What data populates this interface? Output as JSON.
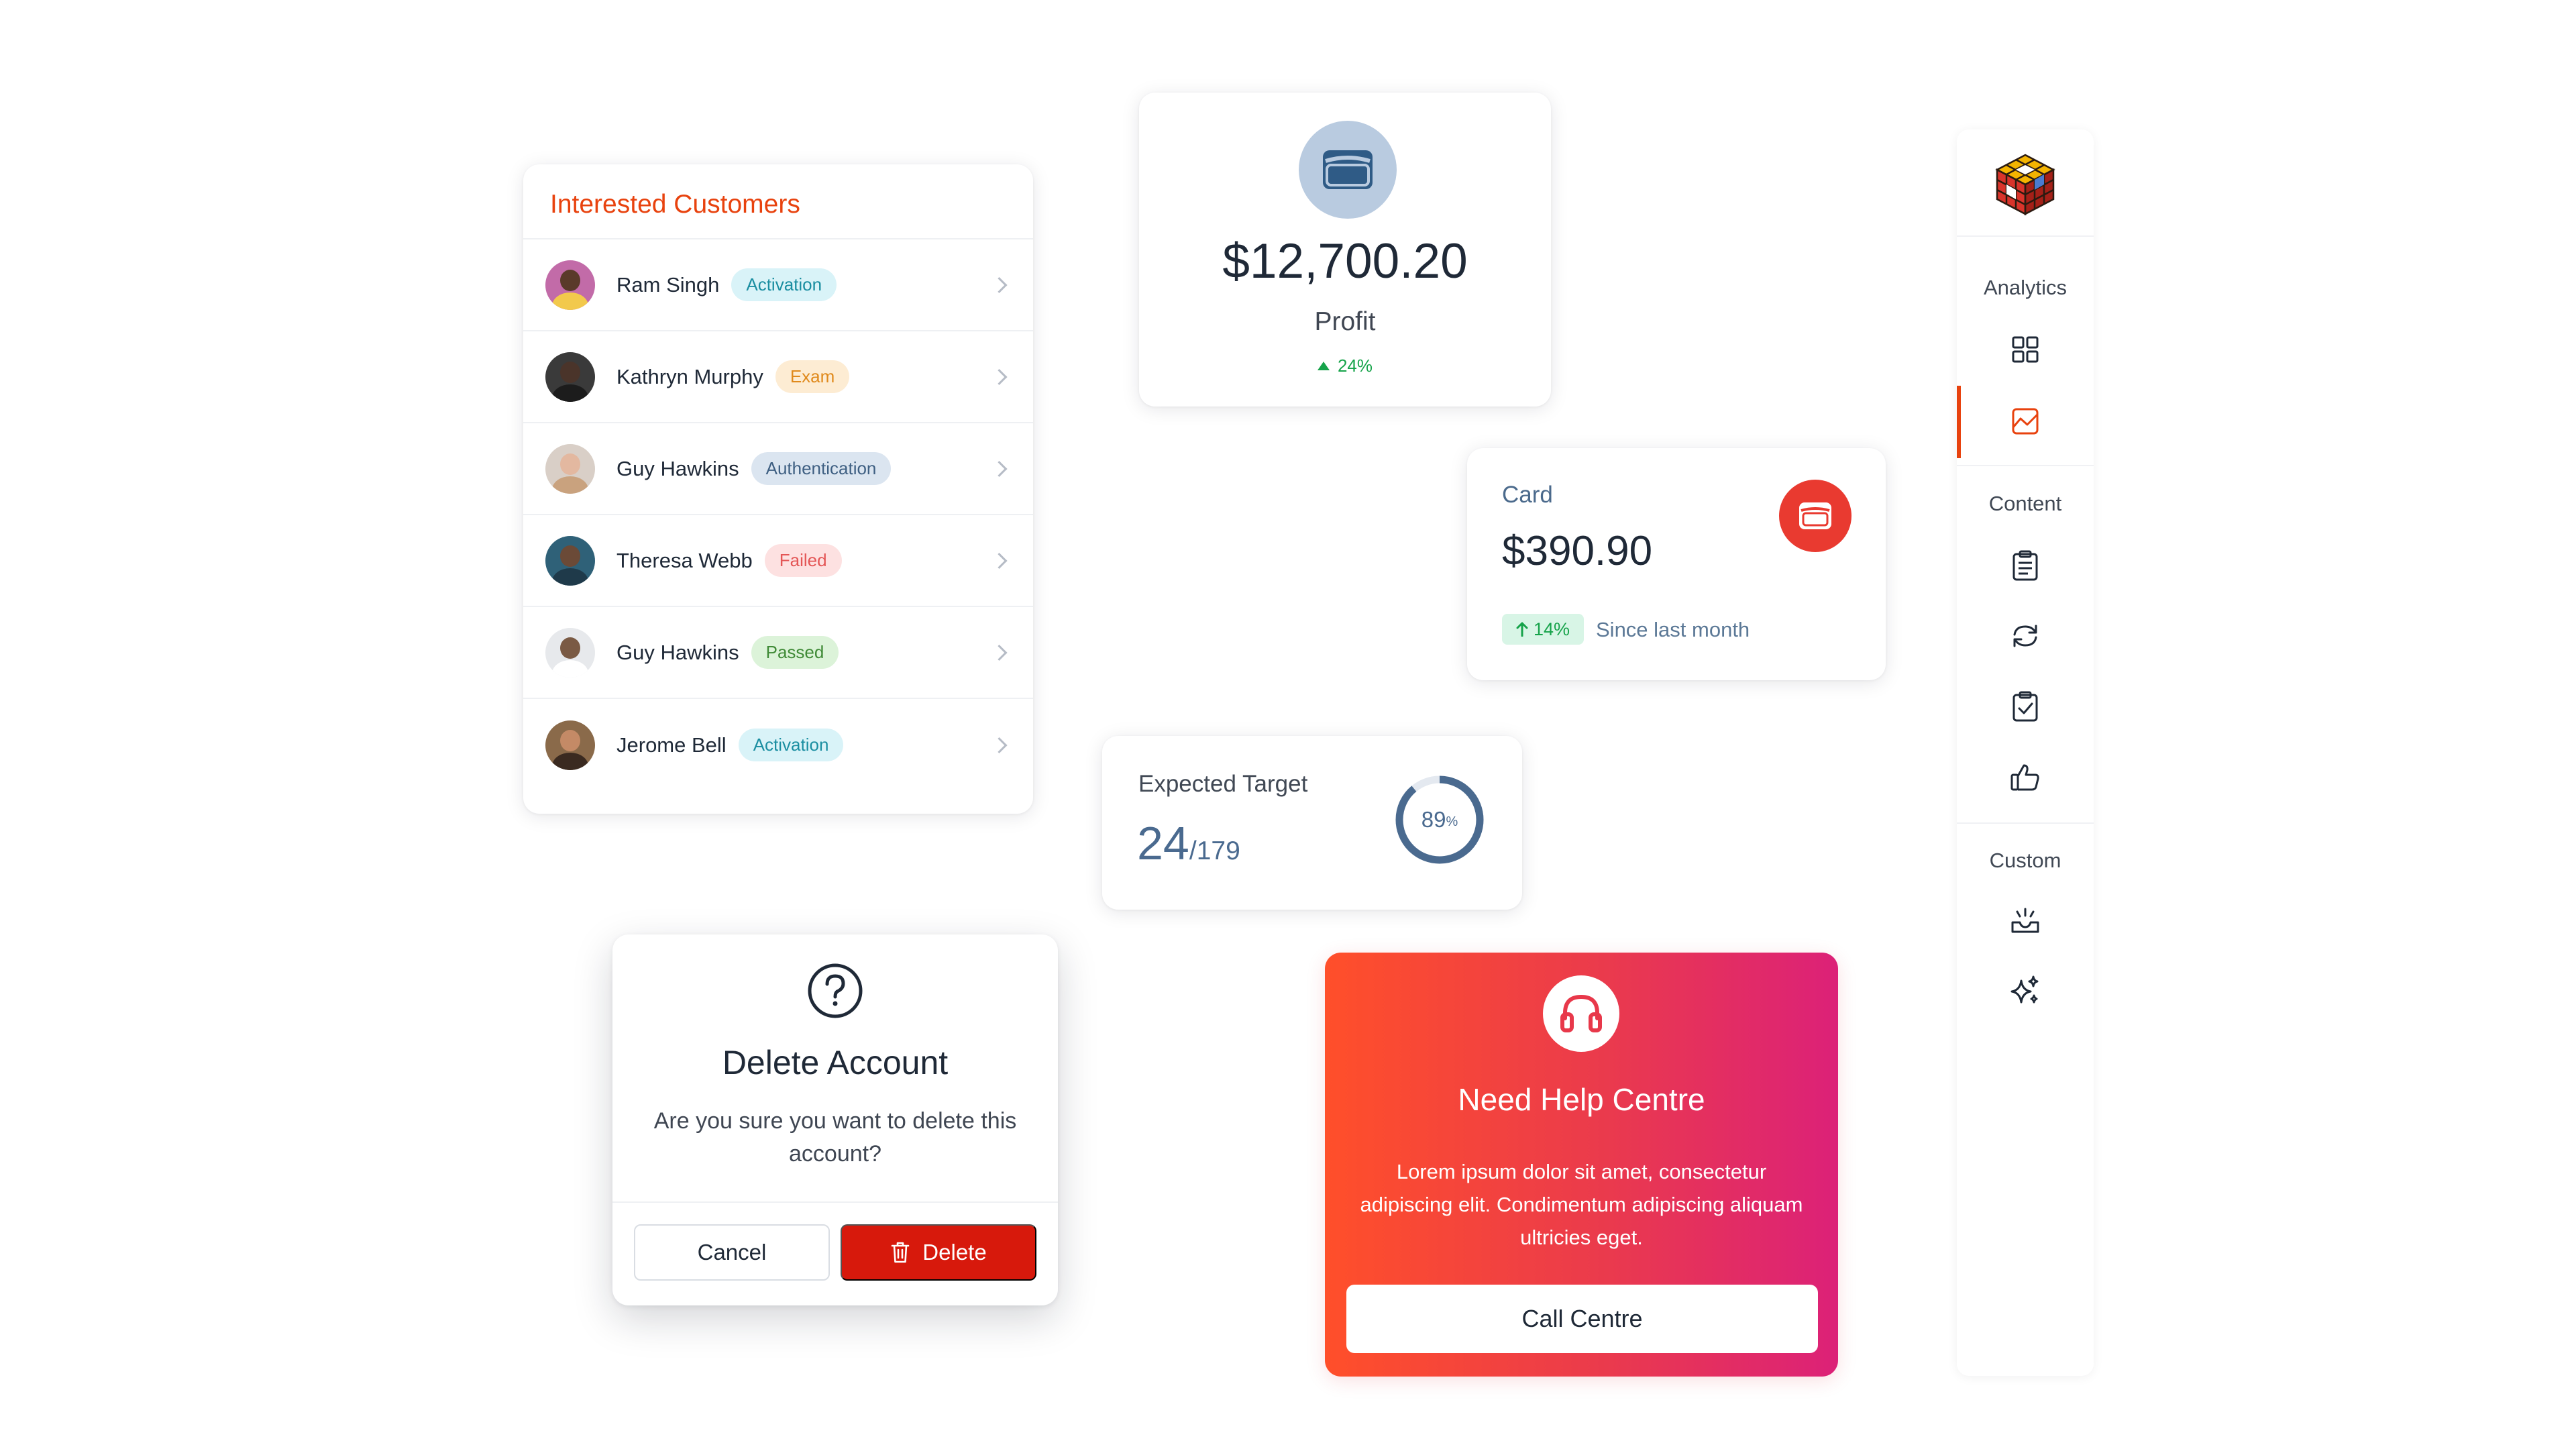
{
  "customers": {
    "title": "Interested Customers",
    "rows": [
      {
        "name": "Ram Singh",
        "status": "Activation",
        "badge_bg": "#d9f3f8",
        "badge_fg": "#1a8ea1",
        "skin": "#5a3a2a",
        "shirt": "#f2c94c",
        "bg": "#c26ba8"
      },
      {
        "name": "Kathryn Murphy",
        "status": "Exam",
        "badge_bg": "#fdecd3",
        "badge_fg": "#e08a1c",
        "skin": "#4a342a",
        "shirt": "#1c1c1c",
        "bg": "#3a3a3a"
      },
      {
        "name": "Guy Hawkins",
        "status": "Authentication",
        "badge_bg": "#dbe5f0",
        "badge_fg": "#3e5f82",
        "skin": "#e3b8a0",
        "shirt": "#c9a27e",
        "bg": "#d9cfc7"
      },
      {
        "name": "Theresa Webb",
        "status": "Failed",
        "badge_bg": "#fde1e1",
        "badge_fg": "#e45656",
        "skin": "#6b4a37",
        "shirt": "#1f3a4a",
        "bg": "#2f6178"
      },
      {
        "name": "Guy Hawkins",
        "status": "Passed",
        "badge_bg": "#dcf3d9",
        "badge_fg": "#3f8a36",
        "skin": "#7a5a44",
        "shirt": "#ffffff",
        "bg": "#e7e9ec"
      },
      {
        "name": "Jerome Bell",
        "status": "Activation",
        "badge_bg": "#d9f3f8",
        "badge_fg": "#1a8ea1",
        "skin": "#c48a66",
        "shirt": "#3a2a20",
        "bg": "#8a6a4a"
      }
    ]
  },
  "profit": {
    "amount": "$12,700.20",
    "label": "Profit",
    "growth": "24%",
    "icon": "wallet-icon"
  },
  "card": {
    "title": "Card",
    "amount": "$390.90",
    "growth": "14%",
    "since": "Since last month",
    "icon": "wallet-icon"
  },
  "target": {
    "title": "Expected Target",
    "value": "24",
    "total": "/179",
    "percent": "89",
    "percent_sign": "%",
    "percent_fraction": 0.89
  },
  "delete_dialog": {
    "title": "Delete Account",
    "message": "Are you sure you want to delete this account?",
    "cancel_label": "Cancel",
    "delete_label": "Delete",
    "icon": "question-icon"
  },
  "help": {
    "title": "Need Help Centre",
    "description": "Lorem ipsum dolor sit amet, consectetur adipiscing elit. Condimentum adipiscing aliquam ultricies eget.",
    "cta_label": "Call Centre",
    "icon": "headset-icon"
  },
  "sidebar": {
    "logo": "rubiks-cube-logo",
    "sections": [
      {
        "label": "Analytics",
        "items": [
          "grid-icon",
          "chart-icon"
        ]
      },
      {
        "label": "Content",
        "items": [
          "clipboard-icon",
          "refresh-icon",
          "checklist-icon",
          "thumbs-up-icon"
        ]
      },
      {
        "label": "Custom",
        "items": [
          "inbox-icon",
          "sparkles-icon"
        ]
      }
    ],
    "active_item": "chart-icon"
  },
  "colors": {
    "accent": "#e8420e",
    "danger": "#d7190c",
    "success": "#16a34a",
    "gradient_start": "#ff4f2a",
    "gradient_end": "#dc2178"
  }
}
